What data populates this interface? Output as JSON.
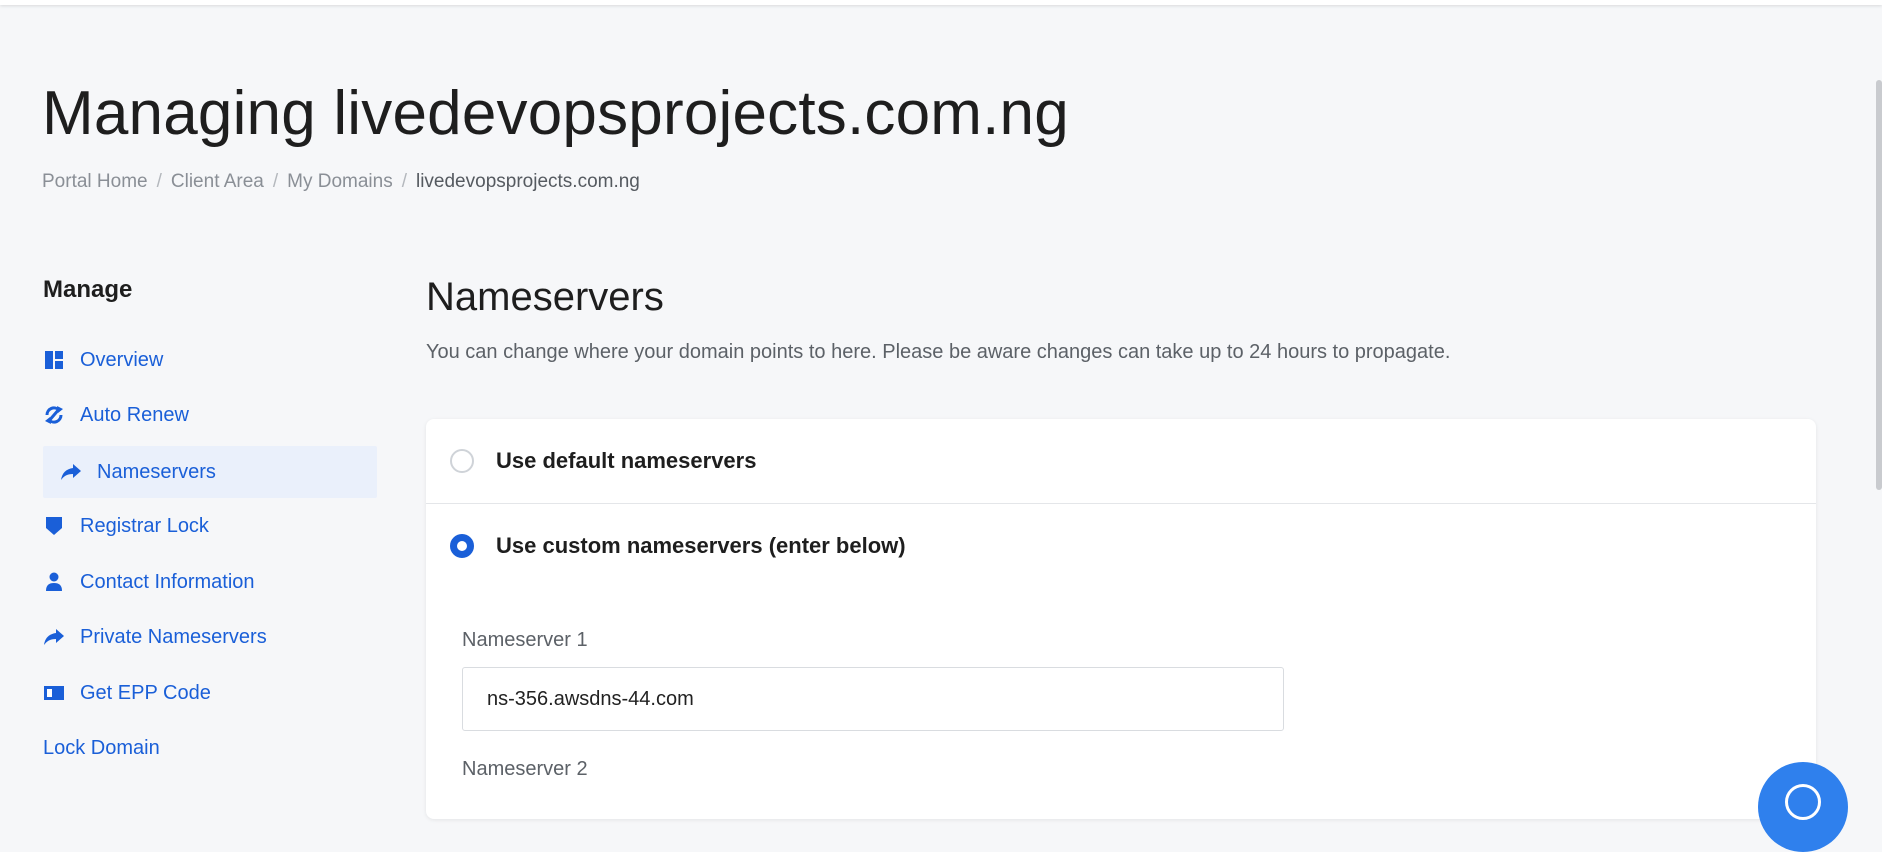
{
  "page": {
    "title": "Managing livedevopsprojects.com.ng"
  },
  "breadcrumb": {
    "items": [
      "Portal Home",
      "Client Area",
      "My Domains"
    ],
    "current": "livedevopsprojects.com.ng",
    "separator": "/"
  },
  "sidebar": {
    "heading": "Manage",
    "items": [
      {
        "label": "Overview",
        "icon": "dashboard-icon"
      },
      {
        "label": "Auto Renew",
        "icon": "sync-icon"
      },
      {
        "label": "Nameservers",
        "icon": "share-arrow-icon",
        "active": true
      },
      {
        "label": "Registrar Lock",
        "icon": "shield-icon"
      },
      {
        "label": "Contact Information",
        "icon": "user-icon"
      },
      {
        "label": "Private Nameservers",
        "icon": "share-arrow-icon"
      },
      {
        "label": "Get EPP Code",
        "icon": "id-card-icon"
      },
      {
        "label": "Lock Domain"
      }
    ]
  },
  "nameservers": {
    "heading": "Nameservers",
    "description": "You can change where your domain points to here. Please be aware changes can take up to 24 hours to propagate.",
    "option_default": "Use default nameservers",
    "option_custom": "Use custom nameservers (enter below)",
    "selected": "custom",
    "fields": [
      {
        "label": "Nameserver 1",
        "value": "ns-356.awsdns-44.com"
      },
      {
        "label": "Nameserver 2",
        "value": ""
      }
    ]
  },
  "colors": {
    "accent": "#1a5fd8",
    "background": "#f6f7f9",
    "active_bg": "#eaf0fb",
    "chat_button": "#2f80ed"
  }
}
